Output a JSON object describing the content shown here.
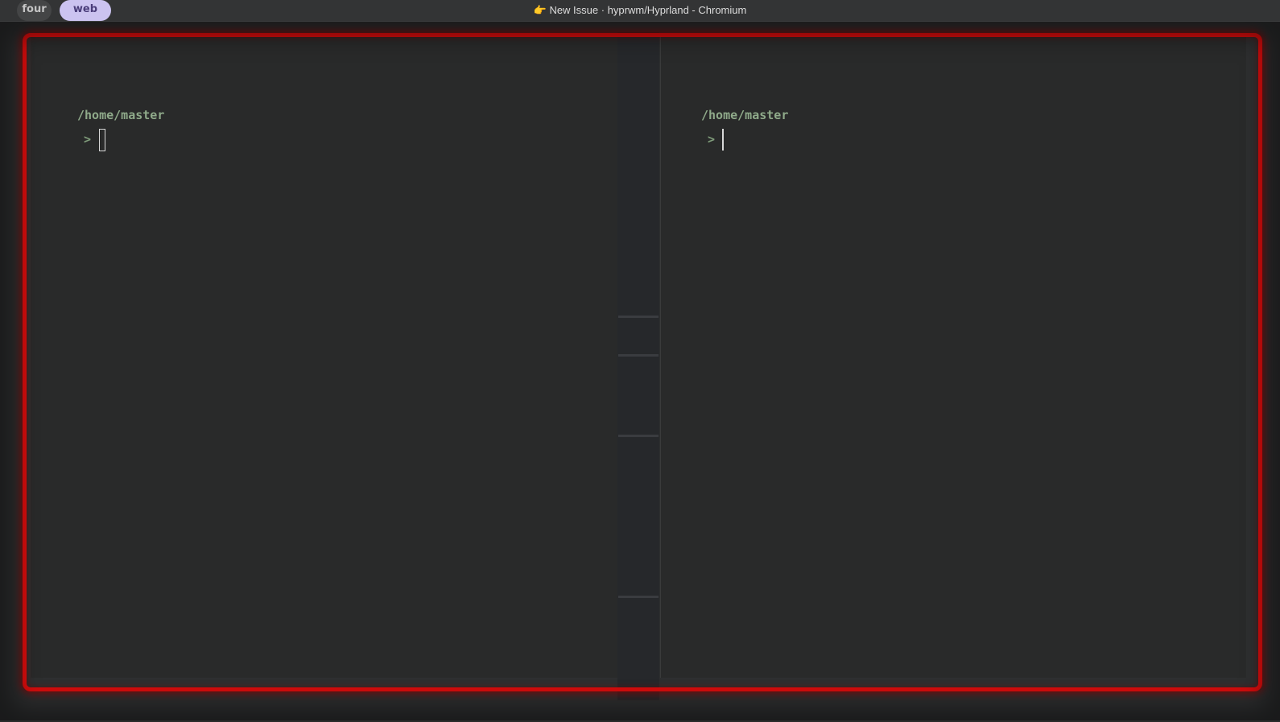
{
  "topbar": {
    "workspaces": [
      {
        "label": "four",
        "active": false
      },
      {
        "label": "web",
        "active": true
      }
    ],
    "window_title": "👉 New Issue · hyprwm/Hyprland - Chromium"
  },
  "terminals": [
    {
      "path": "/home/master",
      "prompt": ">",
      "cursor": "block"
    },
    {
      "path": "/home/master",
      "prompt": ">",
      "cursor": "bar"
    }
  ],
  "colors": {
    "accent_active_workspace": "#cbc3f0",
    "active_border": "#d40c0c",
    "terminal_path": "#8faa8a",
    "terminal_bg": "#292a2a"
  }
}
